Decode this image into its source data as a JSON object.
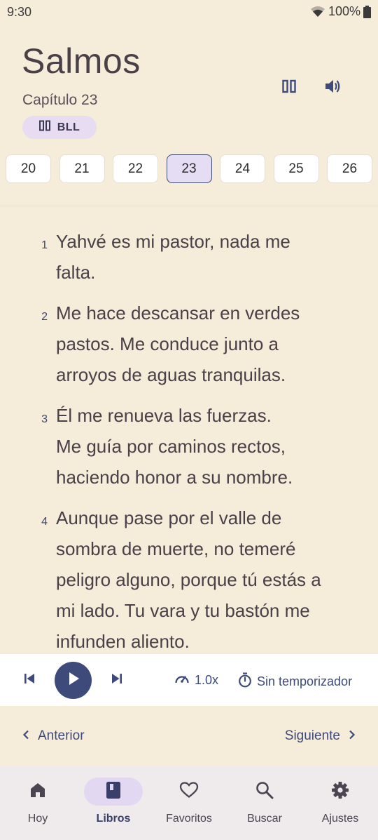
{
  "status_bar": {
    "time": "9:30",
    "battery": "100%"
  },
  "header": {
    "book_title": "Salmos",
    "chapter_label": "Capítulo 23",
    "version": "BLL",
    "icons": {
      "parallel": "parallel-view-icon",
      "audio": "volume-icon"
    }
  },
  "chapters": [
    "20",
    "21",
    "22",
    "23",
    "24",
    "25",
    "26"
  ],
  "active_chapter": "23",
  "verses": [
    {
      "num": "1",
      "lines": [
        "Yahvé es mi pastor, nada me",
        "falta."
      ]
    },
    {
      "num": "2",
      "lines": [
        "Me hace descansar en verdes",
        "pastos. Me conduce junto a",
        "arroyos de aguas tranquilas."
      ]
    },
    {
      "num": "3",
      "lines": [
        "Él me renueva las fuerzas.",
        "Me guía por caminos rectos,",
        "haciendo honor a su nombre."
      ]
    },
    {
      "num": "4",
      "lines": [
        "Aunque pase por el valle de",
        "sombra de muerte, no temeré",
        "peligro alguno, porque tú estás a",
        "mi lado. Tu vara y tu bastón me",
        "infunden aliento."
      ]
    }
  ],
  "player": {
    "speed": "1.0x",
    "timer": "Sin temporizador",
    "icons": {
      "prev": "skip-previous-icon",
      "play": "play-icon",
      "next": "skip-next-icon",
      "speed": "speed-gauge-icon",
      "timer": "timer-icon"
    }
  },
  "chapter_nav": {
    "previous": "Anterior",
    "next": "Siguiente"
  },
  "bottom_nav": [
    {
      "label": "Hoy",
      "icon": "home-icon"
    },
    {
      "label": "Libros",
      "icon": "book-icon"
    },
    {
      "label": "Favoritos",
      "icon": "heart-icon"
    },
    {
      "label": "Buscar",
      "icon": "search-icon"
    },
    {
      "label": "Ajustes",
      "icon": "gear-icon"
    }
  ],
  "active_nav": "Libros",
  "colors": {
    "background": "#f6ecda",
    "accent": "#3d4a7a",
    "chip": "#e7dcf1",
    "bottom_nav": "#efeaeb"
  }
}
